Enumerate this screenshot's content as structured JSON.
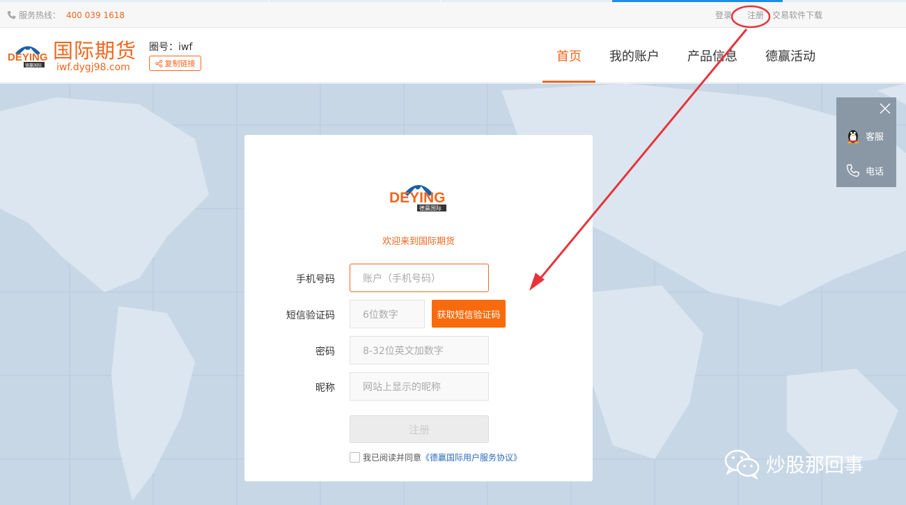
{
  "topbar": {
    "hotline_label": "服务热线：",
    "hotline_number": "400 039 1618",
    "links": [
      "登录",
      "注册",
      "交易软件下载"
    ]
  },
  "header": {
    "logo_text": "DEYING",
    "logo_sub": "德赢国际",
    "brand_title": "国际期货",
    "brand_url": "iwf.dygj98.com",
    "circle_id": "圈号：iwf",
    "copy_link": "复制链接",
    "nav": [
      "首页",
      "我的账户",
      "产品信息",
      "德赢活动"
    ],
    "active_nav": "首页"
  },
  "form": {
    "welcome": "欢迎来到国际期货",
    "phone_label": "手机号码",
    "phone_placeholder": "账户（手机号码）",
    "sms_label": "短信验证码",
    "sms_placeholder": "6位数字",
    "sms_button": "获取短信验证码",
    "password_label": "密码",
    "password_placeholder": "8-32位英文加数字",
    "nickname_label": "昵称",
    "nickname_placeholder": "网站上显示的昵称",
    "register_button": "注册",
    "agree_text": "我已阅读并同意",
    "agree_link": "《德赢国际用户服务协议》"
  },
  "float_panel": {
    "service": "客服",
    "phone": "电话"
  },
  "watermark": "炒股那回事",
  "colors": {
    "brand_orange": "#f0661d",
    "sms_button": "#f76b0c",
    "annotation_red": "#e8333a",
    "link_blue": "#2a6cbc"
  }
}
